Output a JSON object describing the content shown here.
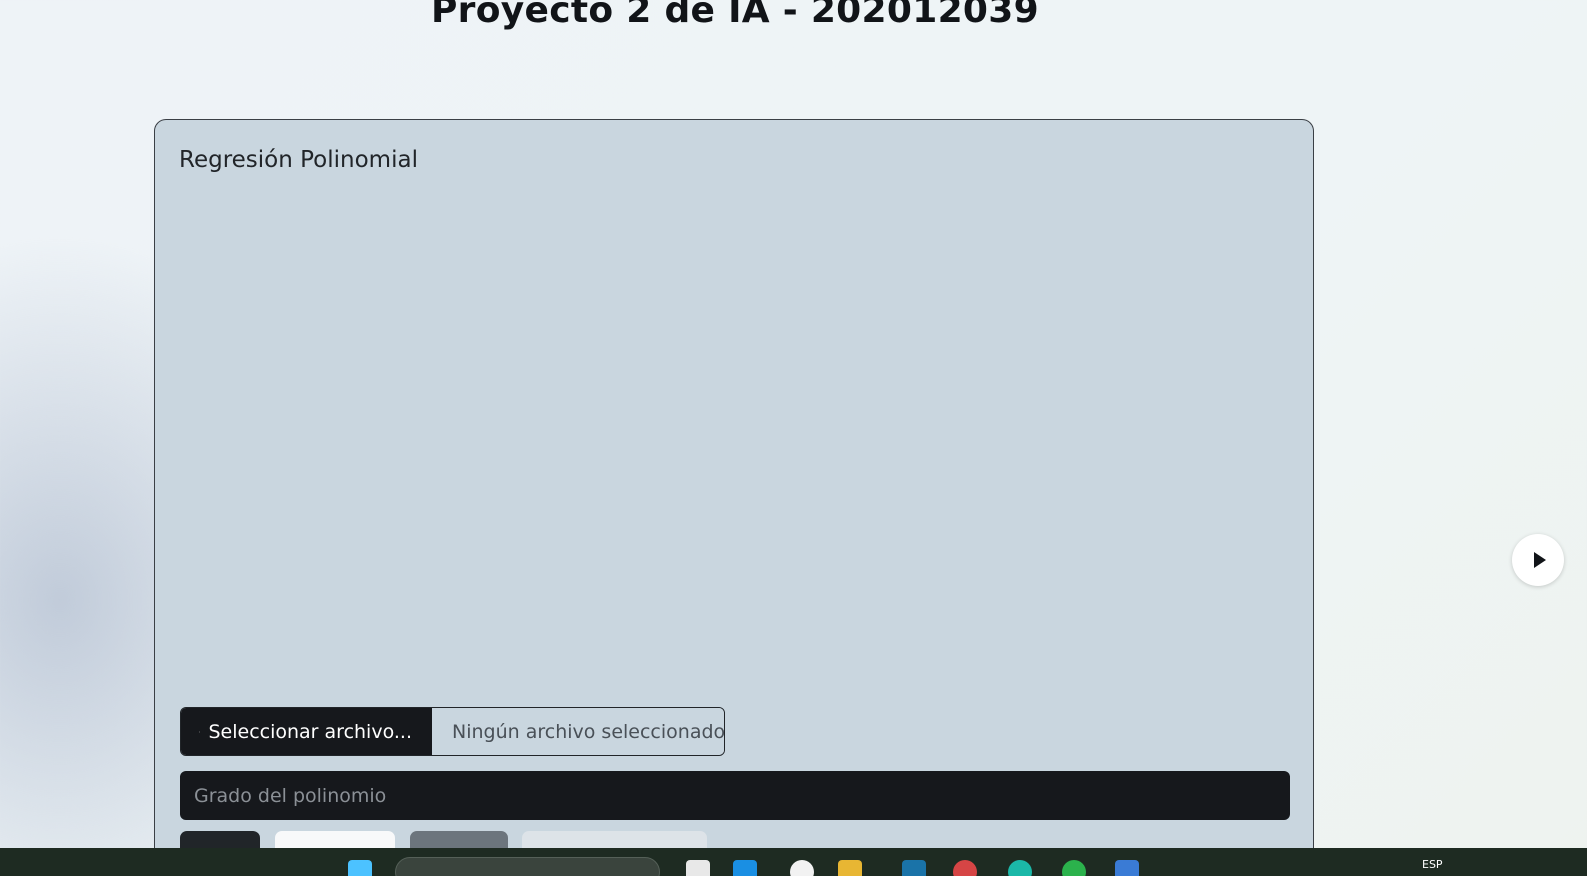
{
  "page": {
    "title": "Proyecto 2 de IA - 202012039"
  },
  "card": {
    "title": "Regresión Polinomial",
    "file_button_label": "Seleccionar archivo...",
    "file_status": "Ningún archivo seleccionado",
    "degree_placeholder": "Grado del polinomio",
    "buttons": [
      {
        "label": ""
      },
      {
        "label": ""
      },
      {
        "label": ""
      },
      {
        "label": ""
      }
    ]
  },
  "carousel": {
    "next_icon": "caret-right-icon"
  },
  "taskbar": {
    "language": "ESP"
  },
  "colors": {
    "card_background": "#c9d6df",
    "dark_control": "#16181c",
    "taskbar": "#1e2b22"
  }
}
